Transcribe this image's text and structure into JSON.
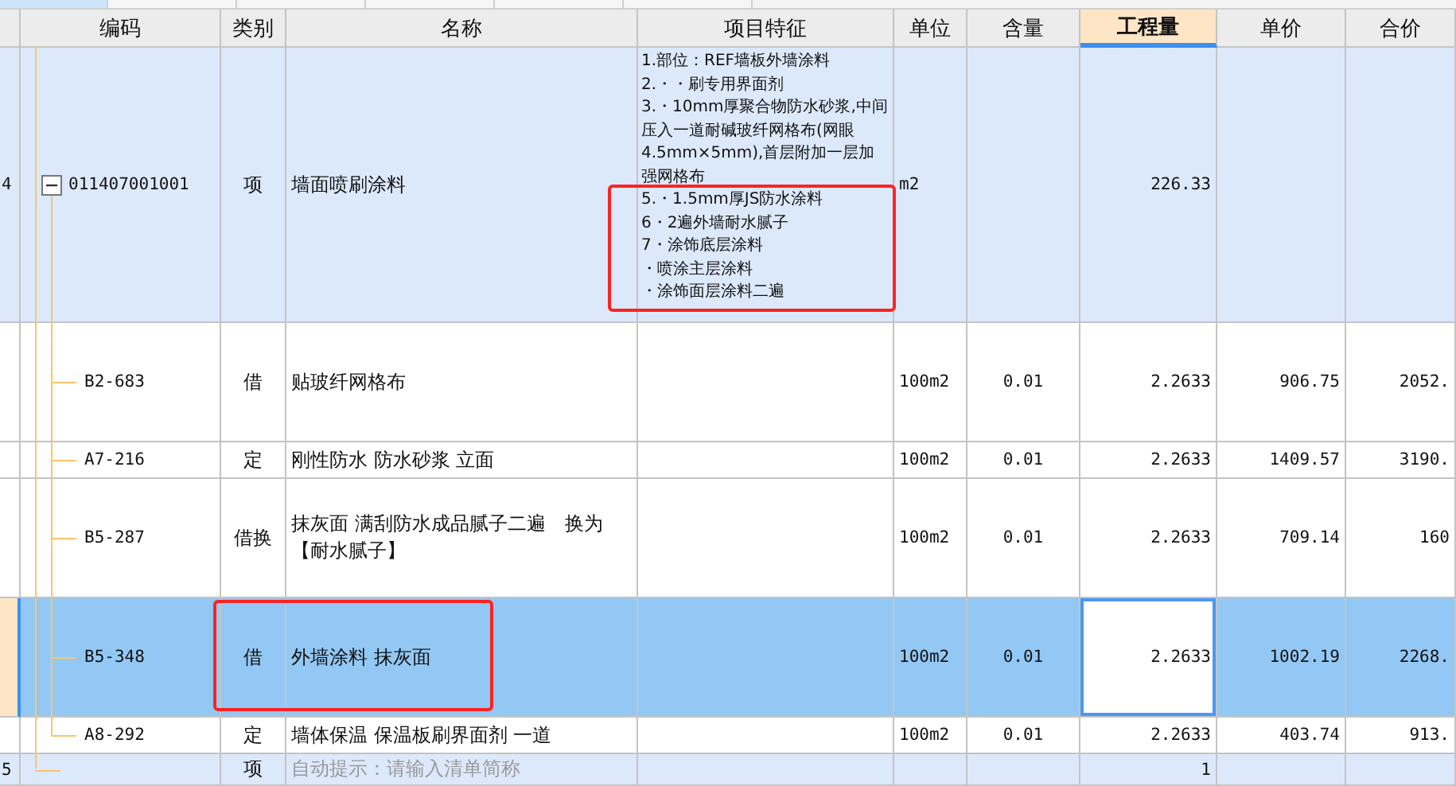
{
  "tab_strip": {
    "tabs": [
      {
        "selected": true
      },
      {
        "selected": false
      },
      {
        "selected": false
      },
      {
        "selected": false
      },
      {
        "selected": false
      },
      {
        "selected": false
      }
    ]
  },
  "table": {
    "columns": [
      {
        "label": "编码",
        "selected": false
      },
      {
        "label": "类别",
        "selected": false
      },
      {
        "label": "名称",
        "selected": false
      },
      {
        "label": "项目特征",
        "selected": false
      },
      {
        "label": "单位",
        "selected": false
      },
      {
        "label": "含量",
        "selected": false
      },
      {
        "label": "工程量",
        "selected": true
      },
      {
        "label": "单价",
        "selected": false
      },
      {
        "label": "合价",
        "selected": false
      }
    ],
    "rows": [
      {
        "row_number": "4",
        "code": "011407001001",
        "category": "项",
        "name": "墙面喷刷涂料",
        "features": [
          {
            "text": "1.部位：REF墙板外墙涂料",
            "marked": false
          },
          {
            "text": "2.・・刷专用界面剂",
            "marked": false
          },
          {
            "text": "3.・10mm厚聚合物防水砂浆,中间压入一道耐碱玻纤网格布(网眼",
            "marked": false
          },
          {
            "text": "4.5mm×5mm),首层附加一层加强网格布",
            "marked": false
          },
          {
            "text": "5.・1.5mm厚JS防水涂料",
            "marked": true
          },
          {
            "text": "6・2遍外墙耐水腻子",
            "marked": true
          },
          {
            "text": "7・涂饰底层涂料",
            "marked": true
          },
          {
            "text": "・喷涂主层涂料",
            "marked": true
          },
          {
            "text": "・涂饰面层涂料二遍",
            "marked": true
          }
        ],
        "unit": "m2",
        "quantity": "226.33",
        "selected": false,
        "expanded": true,
        "children": [
          {
            "code": "B2-683",
            "category": "借",
            "name": "贴玻纤网格布",
            "unit": "100m2",
            "content": "0.01",
            "quantity": "2.2633",
            "unit_price": "906.75",
            "total": "2052.",
            "selected": false,
            "marked": false
          },
          {
            "code": "A7-216",
            "category": "定",
            "name": "刚性防水 防水砂浆 立面",
            "unit": "100m2",
            "content": "0.01",
            "quantity": "2.2633",
            "unit_price": "1409.57",
            "total": "3190.",
            "selected": false,
            "marked": false
          },
          {
            "code": "B5-287",
            "category": "借换",
            "name": "抹灰面 满刮防水成品腻子二遍　换为【耐水腻子】",
            "unit": "100m2",
            "content": "0.01",
            "quantity": "2.2633",
            "unit_price": "709.14",
            "total": "160",
            "selected": false,
            "marked": false
          },
          {
            "code": "B5-348",
            "category": "借",
            "name": "外墙涂料 抹灰面",
            "unit": "100m2",
            "content": "0.01",
            "quantity": "2.2633",
            "unit_price": "1002.19",
            "total": "2268.",
            "selected": true,
            "marked": true,
            "focused": true
          },
          {
            "code": "A8-292",
            "category": "定",
            "name": "墙体保温 保温板刷界面剂 一道",
            "unit": "100m2",
            "content": "0.01",
            "quantity": "2.2633",
            "unit_price": "403.74",
            "total": "913.",
            "selected": false,
            "marked": false
          }
        ]
      },
      {
        "row_number": "5",
        "category": "项",
        "placeholder": "自动提示：请输入清单简称",
        "quantity": "1",
        "selected": false
      }
    ]
  }
}
